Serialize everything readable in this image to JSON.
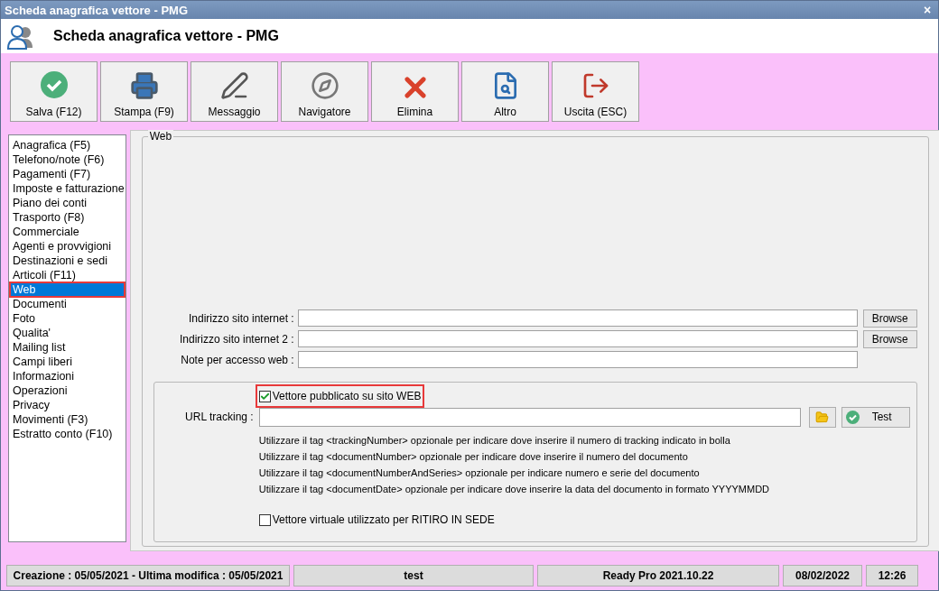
{
  "window": {
    "title": "Scheda anagrafica vettore - PMG",
    "close": "×"
  },
  "header": {
    "title": "Scheda anagrafica vettore - PMG"
  },
  "toolbar": [
    {
      "label": "Salva (F12)"
    },
    {
      "label": "Stampa (F9)"
    },
    {
      "label": "Messaggio"
    },
    {
      "label": "Navigatore"
    },
    {
      "label": "Elimina"
    },
    {
      "label": "Altro"
    },
    {
      "label": "Uscita (ESC)"
    }
  ],
  "sidebar": {
    "items": [
      {
        "label": "Anagrafica (F5)",
        "selected": false,
        "highlighted": false
      },
      {
        "label": "Telefono/note (F6)",
        "selected": false,
        "highlighted": false
      },
      {
        "label": "Pagamenti (F7)",
        "selected": false,
        "highlighted": false
      },
      {
        "label": "Imposte e fatturazione",
        "selected": false,
        "highlighted": false
      },
      {
        "label": "Piano dei conti",
        "selected": false,
        "highlighted": false
      },
      {
        "label": "Trasporto (F8)",
        "selected": false,
        "highlighted": false
      },
      {
        "label": "Commerciale",
        "selected": false,
        "highlighted": false
      },
      {
        "label": "Agenti e provvigioni",
        "selected": false,
        "highlighted": false
      },
      {
        "label": "Destinazioni e sedi",
        "selected": false,
        "highlighted": false
      },
      {
        "label": "Articoli (F11)",
        "selected": false,
        "highlighted": false
      },
      {
        "label": "Web",
        "selected": true,
        "highlighted": true
      },
      {
        "label": "Documenti",
        "selected": false,
        "highlighted": false
      },
      {
        "label": "Foto",
        "selected": false,
        "highlighted": false
      },
      {
        "label": "Qualita'",
        "selected": false,
        "highlighted": false
      },
      {
        "label": "Mailing list",
        "selected": false,
        "highlighted": false
      },
      {
        "label": "Campi liberi",
        "selected": false,
        "highlighted": false
      },
      {
        "label": "Informazioni",
        "selected": false,
        "highlighted": false
      },
      {
        "label": "Operazioni",
        "selected": false,
        "highlighted": false
      },
      {
        "label": "Privacy",
        "selected": false,
        "highlighted": false
      },
      {
        "label": "Movimenti (F3)",
        "selected": false,
        "highlighted": false
      },
      {
        "label": "Estratto conto (F10)",
        "selected": false,
        "highlighted": false
      }
    ]
  },
  "panel": {
    "title": "Web",
    "fields": [
      {
        "label": "Indirizzo sito internet :",
        "button": "Browse"
      },
      {
        "label": "Indirizzo sito internet 2 :",
        "button": "Browse"
      },
      {
        "label": "Note per accesso web :"
      }
    ],
    "published": {
      "label": "Vettore pubblicato su sito WEB",
      "checked": true,
      "highlighted": true
    },
    "url_tracking": {
      "label": "URL tracking :",
      "test_button": "Test"
    },
    "hints": [
      "Utilizzare il tag <trackingNumber> opzionale per indicare dove inserire il numero di tracking indicato in bolla",
      "Utilizzare il tag <documentNumber> opzionale per indicare dove inserire il numero del documento",
      "Utilizzare il tag <documentNumberAndSeries> opzionale per indicare numero e serie del documento",
      "Utilizzare il tag <documentDate> opzionale per indicare dove inserire la data del documento in formato YYYYMMDD"
    ],
    "virtual": {
      "label": "Vettore virtuale utilizzato per RITIRO IN SEDE",
      "checked": false
    }
  },
  "status_bar": [
    "Creazione : 05/05/2021 - Ultima modifica : 05/05/2021",
    "test",
    "Ready Pro 2021.10.22",
    "08/02/2022",
    "12:26"
  ]
}
